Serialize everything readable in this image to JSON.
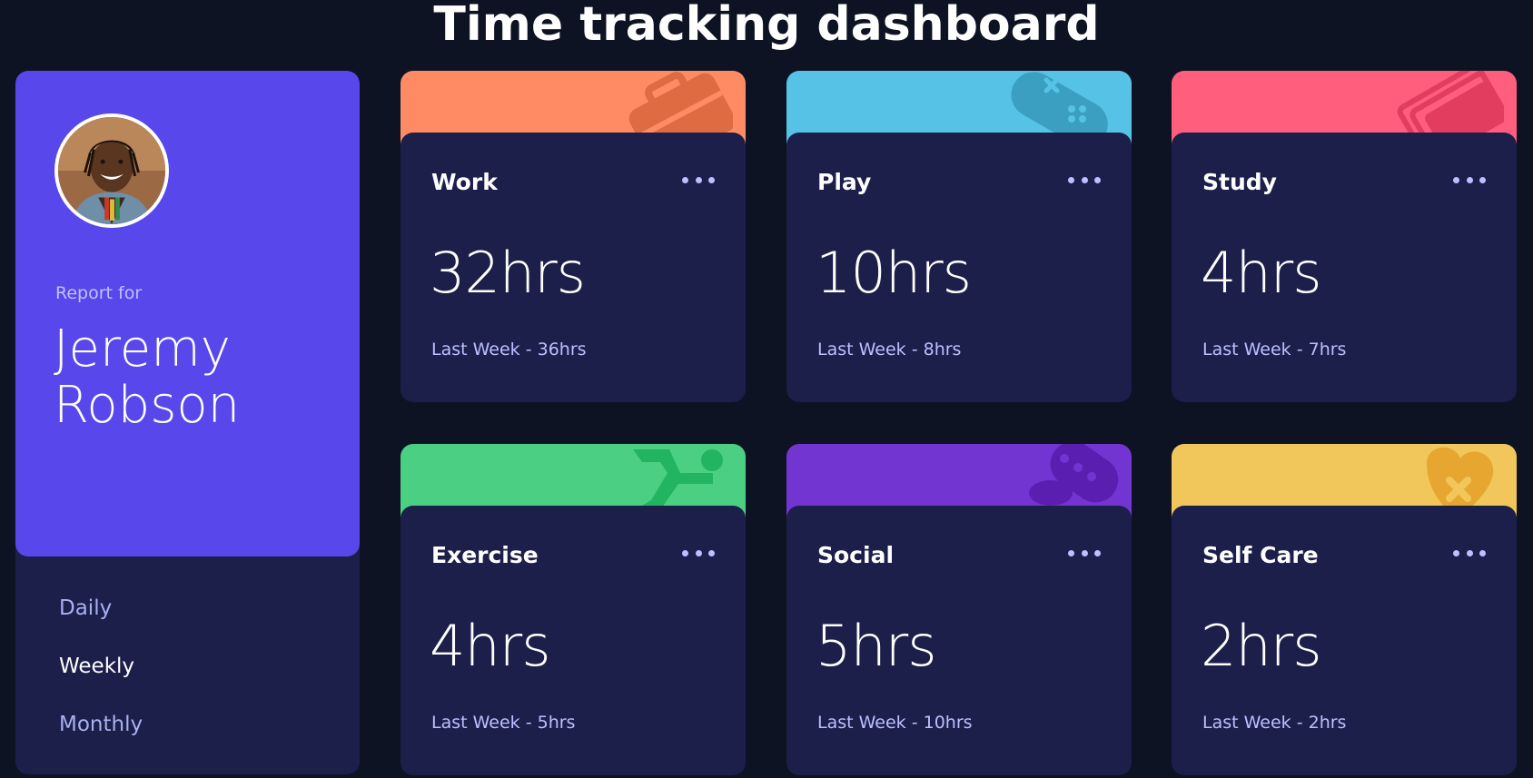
{
  "title": "Time tracking dashboard",
  "profile": {
    "report_for": "Report for",
    "name": "Jeremy Robson",
    "periods": [
      {
        "label": "Daily",
        "active": false
      },
      {
        "label": "Weekly",
        "active": true
      },
      {
        "label": "Monthly",
        "active": false
      }
    ]
  },
  "cards": [
    {
      "title": "Work",
      "hours": "32hrs",
      "previous": "Last Week - 36hrs",
      "color": "#ff8b64",
      "icon": "briefcase-icon",
      "icon_color": "#df6b43"
    },
    {
      "title": "Play",
      "hours": "10hrs",
      "previous": "Last Week - 8hrs",
      "color": "#56c2e6",
      "icon": "gamepad-icon",
      "icon_color": "#3a9fc0"
    },
    {
      "title": "Study",
      "hours": "4hrs",
      "previous": "Last Week - 7hrs",
      "color": "#ff5e7d",
      "icon": "book-icon",
      "icon_color": "#e23d5f"
    },
    {
      "title": "Exercise",
      "hours": "4hrs",
      "previous": "Last Week - 5hrs",
      "color": "#4bcf82",
      "icon": "running-icon",
      "icon_color": "#22b461"
    },
    {
      "title": "Social",
      "hours": "5hrs",
      "previous": "Last Week - 10hrs",
      "color": "#7335d2",
      "icon": "chat-icon",
      "icon_color": "#5a1fb0"
    },
    {
      "title": "Self Care",
      "hours": "2hrs",
      "previous": "Last Week - 2hrs",
      "color": "#f1c75b",
      "icon": "heart-icon",
      "icon_color": "#e6a62f"
    }
  ]
}
